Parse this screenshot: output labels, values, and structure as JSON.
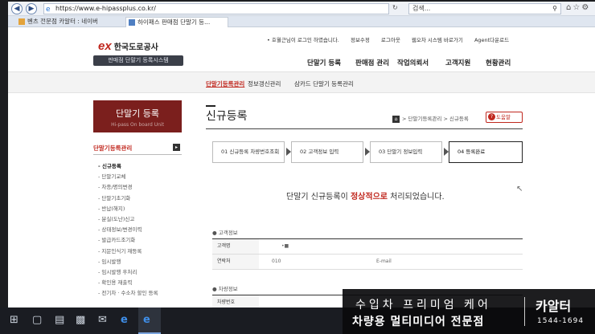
{
  "browser": {
    "url": "https://www.e-hipassplus.co.kr/",
    "search_placeholder": "검색...",
    "tabs": [
      "벤츠 전문점 카알터 : 네이버",
      "하이패스 판매점 단말기 등..."
    ]
  },
  "site": {
    "logo_mark": "ex",
    "logo_name": "한국도로공사",
    "system_name": "판매점 단말기 등록시스템",
    "util_links": [
      "• 호월근님이 로그인 하였습니다.",
      "정보수정",
      "로그아웃",
      "웹오차 시스템 바로가기",
      "Agent다운로드"
    ],
    "gnb": [
      "단말기 등록",
      "판매점 관리",
      "작업의뢰서",
      "고객지원",
      "현황관리"
    ],
    "lnb": [
      "단말기등록관리",
      "정보갱신관리",
      "삼카드 단말기 등록관리"
    ]
  },
  "sidebar": {
    "card_title": "단말기 등록",
    "card_sub": "Hi-pass On board Unit",
    "section_title": "단말기등록관리",
    "items": [
      "- 신규등록",
      "- 단말기교체",
      "- 차종/명의변경",
      "- 단말기초기화",
      "- 반납(해지)",
      "- 분실(도난)신고",
      "- 상태정보/변경이력",
      "- 발급카드조기화",
      "- 지문인식기 재등록",
      "- 임시발행",
      "- 임시발행 후처리",
      "- 확인용 재출력",
      "- 전기차 · 수소차 할인 등록"
    ]
  },
  "main": {
    "page_title": "신규등록",
    "breadcrumb": [
      "> 단말기등록관리",
      "> 신규등록"
    ],
    "help_label": "도움말",
    "steps": [
      "01 신규등록 차량번호조회",
      "02 고객정보 입력",
      "03 단말기 정보입력",
      "04 등록완료"
    ],
    "message_pre": "단말기 신규등록이 ",
    "message_hl": "정상적으로",
    "message_post": " 처리되었습니다.",
    "customer_section": "● 고객정보",
    "customer_rows": [
      {
        "label": "고객명",
        "value": "•■"
      },
      {
        "label": "연락처",
        "value": "010",
        "label2": "E-mail"
      }
    ],
    "vehicle_section": "● 차량정보",
    "vehicle_rows": [
      {
        "label": "차량번호",
        "value": ""
      }
    ]
  },
  "ad": {
    "line1": "수입차 프리미엄 케어",
    "line2": "차량용 멀티미디어 전문점",
    "brand": "카알터",
    "phone": "1544-1694"
  }
}
